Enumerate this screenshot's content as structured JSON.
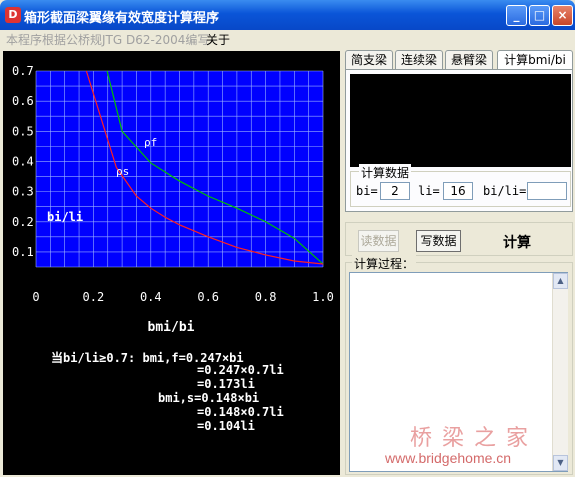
{
  "window": {
    "title": "箱形截面梁翼缘有效宽度计算程序",
    "icon": "app-icon",
    "controls": {
      "minimize": "_",
      "maximize": "□",
      "close": "×"
    }
  },
  "menu": {
    "note": "本程序根据公桥规JTG D62-2004编写",
    "about": "关于"
  },
  "chart_data": {
    "type": "line",
    "xlabel": "bmi/bi",
    "ylabel": "bi/li",
    "xlim": [
      0,
      1.0
    ],
    "ylim": [
      0.05,
      0.7
    ],
    "xticks": [
      "0",
      "0.2",
      "0.4",
      "0.6",
      "0.8",
      "1.0"
    ],
    "yticks": [
      "0.7",
      "0.6",
      "0.5",
      "0.4",
      "0.3",
      "0.2",
      "0.1"
    ],
    "grid": true,
    "series": [
      {
        "name": "ρf",
        "color": "#00c000",
        "x": [
          0.3,
          0.4,
          0.5,
          0.6,
          0.7,
          0.8,
          0.9,
          1.0
        ],
        "y": [
          0.5,
          0.395,
          0.335,
          0.285,
          0.245,
          0.2,
          0.145,
          0.06
        ]
      },
      {
        "name": "ρs",
        "color": "#ff2020",
        "x": [
          0.28,
          0.35,
          0.4,
          0.45,
          0.5,
          0.6,
          0.7,
          0.8,
          0.9,
          1.0
        ],
        "y": [
          0.38,
          0.285,
          0.245,
          0.215,
          0.19,
          0.15,
          0.115,
          0.09,
          0.07,
          0.06
        ]
      }
    ],
    "annotations": [
      "ρf",
      "ρs"
    ]
  },
  "result_text": {
    "line1": "当bi/li≥0.7: bmi,f=0.247×bi",
    "line2": "=0.247×0.7li",
    "line3": "=0.173li",
    "line4": "bmi,s=0.148×bi",
    "line5": "=0.148×0.7li",
    "line6": "=0.104li"
  },
  "tabs": [
    {
      "label": "简支梁",
      "active": false
    },
    {
      "label": "连续梁",
      "active": false
    },
    {
      "label": "悬臂梁",
      "active": false
    },
    {
      "label": "计算bmi/bi",
      "active": true
    }
  ],
  "calc_data": {
    "title": "计算数据",
    "bi_label": "bi=",
    "bi_value": "2",
    "li_label": "li=",
    "li_value": "16",
    "ratio_label": "bi/li=",
    "ratio_value": ""
  },
  "buttons": {
    "read": "读数据",
    "write": "写数据",
    "calc": "计算"
  },
  "process": {
    "title": "计算过程：",
    "content": ""
  },
  "watermark": {
    "cn": "桥梁之家",
    "url": "www.bridgehome.cn"
  }
}
